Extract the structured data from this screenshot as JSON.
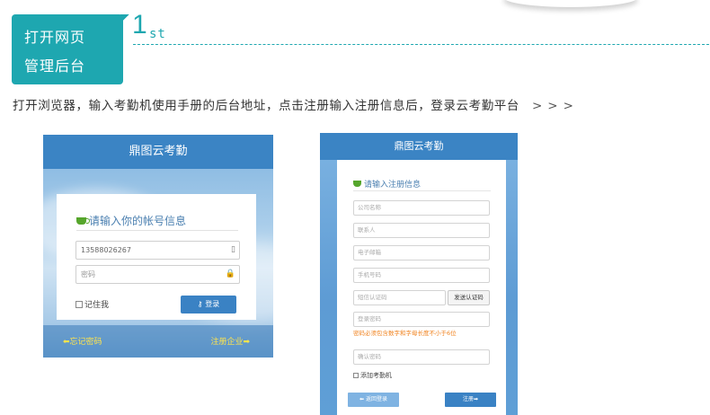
{
  "step": {
    "badge_line1": "打开网页",
    "badge_line2": "管理后台",
    "number": "1",
    "suffix": "st",
    "instruction": "打开浏览器，输入考勤机使用手册的后台地址，点击注册输入注册信息后，登录云考勤平台",
    "arrows": ">>>"
  },
  "login": {
    "title": "鼎图云考勤",
    "card_title": "请输入你的帐号信息",
    "phone_value": "13588026267",
    "password_placeholder": "密码",
    "remember_label": "记住我",
    "login_button": "登录",
    "forgot_link": "忘记密码",
    "register_link": "注册企业",
    "icons": {
      "card": "cup-icon",
      "phone": "mobile-icon",
      "password": "lock-icon",
      "login": "key-icon",
      "forgot": "arrow-left-icon",
      "register": "arrow-right-icon"
    }
  },
  "register": {
    "title": "鼎图云考勤",
    "card_title": "请输入注册信息",
    "fields": {
      "company": "公司名称",
      "contact": "联系人",
      "email": "电子邮箱",
      "phone": "手机号码",
      "sms_code": "短信认证码",
      "password": "登录密码",
      "confirm": "确认密码"
    },
    "sms_button": "发送认证码",
    "password_hint": "密码必须包含数字和字母长度不小于6位",
    "join_label": "添加考勤机",
    "back_button": "返回登录",
    "register_button": "注册"
  },
  "colors": {
    "teal": "#1ea7b0",
    "header_blue": "#3b84c4",
    "button_blue": "#3a82c4",
    "link_yellow": "#ffe44d",
    "hint_orange": "#f0821e"
  }
}
